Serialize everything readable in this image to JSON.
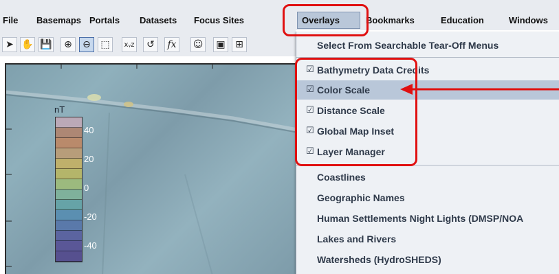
{
  "menubar": {
    "items": [
      "File",
      "Basemaps",
      "Portals",
      "Datasets",
      "Focus Sites",
      "Overlays",
      "Bookmarks",
      "Education",
      "Windows"
    ]
  },
  "toolbar": {
    "buttons": [
      {
        "icon": "pointer-arrow-icon",
        "glyph": "➤"
      },
      {
        "icon": "hand-pan-icon",
        "glyph": "✋"
      },
      {
        "icon": "save-disk-icon",
        "glyph": "💾"
      },
      {
        "icon": "zoom-in-icon",
        "glyph": "⊕"
      },
      {
        "icon": "zoom-out-icon",
        "glyph": "⊖"
      },
      {
        "icon": "select-area-icon",
        "glyph": "⬚"
      },
      {
        "icon": "xyz-icon",
        "glyph": "xᵧz"
      },
      {
        "icon": "lasso-icon",
        "glyph": "↺"
      },
      {
        "icon": "function-fx-icon",
        "glyph": "fx"
      },
      {
        "icon": "face-icon",
        "glyph": "☺"
      },
      {
        "icon": "panel-icon",
        "glyph": "▣"
      },
      {
        "icon": "grid-icon",
        "glyph": "⊞"
      }
    ]
  },
  "legend": {
    "unit": "nT",
    "ticks": [
      "40",
      "20",
      "0",
      "-20",
      "-40"
    ],
    "colors": [
      "#bba9b7",
      "#ad8774",
      "#b98a6b",
      "#b79d7a",
      "#bfb06b",
      "#b4b56a",
      "#9cba7e",
      "#7fb19b",
      "#66a3a7",
      "#5b8fb1",
      "#5a79aa",
      "#5b64a0",
      "#5a5797",
      "#56508f"
    ]
  },
  "overlays_menu": {
    "header": "Select From Searchable Tear-Off Menus",
    "checked_items": [
      {
        "label": "Bathymetry Data Credits",
        "checked": true,
        "highlighted": false
      },
      {
        "label": "Color Scale",
        "checked": true,
        "highlighted": true
      },
      {
        "label": "Distance Scale",
        "checked": true,
        "highlighted": false
      },
      {
        "label": "Global Map Inset",
        "checked": true,
        "highlighted": false
      },
      {
        "label": "Layer Manager",
        "checked": true,
        "highlighted": false
      }
    ],
    "unchecked_items": [
      "Coastlines",
      "Geographic Names",
      "Human Settlements Night Lights (DMSP/NOA",
      "Lakes and Rivers",
      "Watersheds (HydroSHEDS)"
    ]
  },
  "colors": {
    "annotation_red": "#e01010",
    "highlight": "#b9c7d9",
    "menu_bg": "#eef1f5"
  }
}
